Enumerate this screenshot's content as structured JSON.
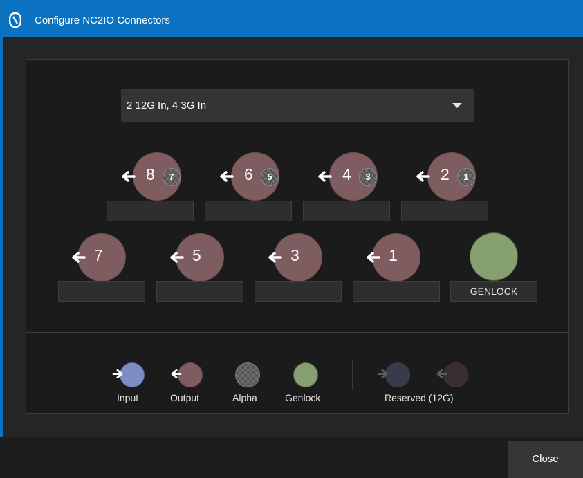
{
  "window": {
    "title": "Configure NC2IO Connectors",
    "accent_color": "#0a72c0"
  },
  "config_select": {
    "value": "2 12G In, 4 3G In"
  },
  "top_row": [
    {
      "number": "8",
      "alpha": "7",
      "role": "output"
    },
    {
      "number": "6",
      "alpha": "5",
      "role": "output"
    },
    {
      "number": "4",
      "alpha": "3",
      "role": "output"
    },
    {
      "number": "2",
      "alpha": "1",
      "role": "output"
    }
  ],
  "bottom_row": [
    {
      "number": "7",
      "role": "output"
    },
    {
      "number": "5",
      "role": "output"
    },
    {
      "number": "3",
      "role": "output"
    },
    {
      "number": "1",
      "role": "output"
    }
  ],
  "genlock": {
    "label": "GENLOCK",
    "color": "#87a072"
  },
  "legend": {
    "input": "Input",
    "output": "Output",
    "alpha": "Alpha",
    "genlock": "Genlock",
    "reserved": "Reserved (12G)"
  },
  "colors": {
    "input": "#7d8ec4",
    "output": "#7e5c60",
    "alpha": "#6d6d6d",
    "genlock": "#87a072"
  },
  "footer": {
    "close_label": "Close"
  }
}
